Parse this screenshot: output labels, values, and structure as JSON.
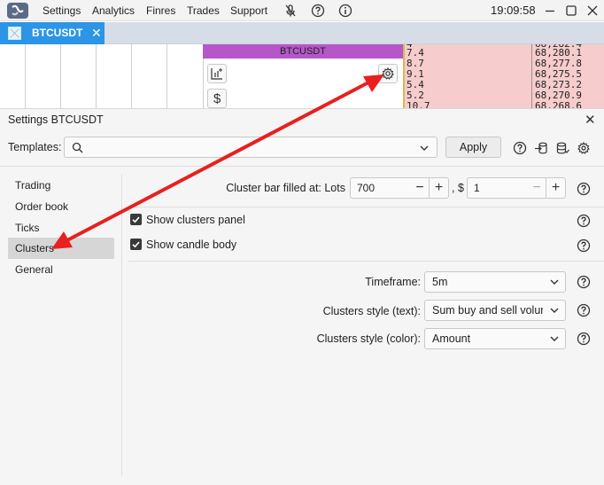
{
  "titlebar": {
    "menu": [
      "Settings",
      "Analytics",
      "Finres",
      "Trades",
      "Support"
    ],
    "clock": "19:09:58",
    "icons": [
      "mic-off-icon",
      "help-icon",
      "info-icon"
    ]
  },
  "tabs": [
    {
      "label": "BTCUSDT",
      "active": true
    }
  ],
  "chart_widget": {
    "title": "BTCUSDT"
  },
  "order_book": {
    "rows": [
      {
        "qty": "7.4",
        "price": "68,280.1"
      },
      {
        "qty": "8.7",
        "price": "68,277.8"
      },
      {
        "qty": "9.1",
        "price": "68,275.5"
      },
      {
        "qty": "5.4",
        "price": "68,273.2"
      },
      {
        "qty": "5.2",
        "price": "68,270.9"
      },
      {
        "qty": "10.7",
        "price": "68,268.6"
      }
    ]
  },
  "settings": {
    "title": "Settings BTCUSDT",
    "templates_label": "Templates:",
    "templates_value": "",
    "apply_label": "Apply",
    "sidebar": [
      {
        "label": "Trading",
        "active": false
      },
      {
        "label": "Order book",
        "active": false
      },
      {
        "label": "Ticks",
        "active": false
      },
      {
        "label": "Clusters",
        "active": true
      },
      {
        "label": "General",
        "active": false
      }
    ],
    "cluster_bar": {
      "label": "Cluster bar filled at: Lots",
      "lots_value": "700",
      "sep_label": ", $",
      "usd_value": "1"
    },
    "checkboxes": [
      {
        "label": "Show clusters panel",
        "checked": true
      },
      {
        "label": "Show candle body",
        "checked": true
      }
    ],
    "selects": [
      {
        "label": "Timeframe:",
        "value": "5m"
      },
      {
        "label": "Clusters style (text):",
        "value": "Sum buy and sell volume"
      },
      {
        "label": "Clusters style (color):",
        "value": "Amount"
      }
    ]
  },
  "colors": {
    "tab_active": "#2c95e6",
    "widget_header": "#b557c9",
    "order_book_ask": "#f6cccc",
    "annotation_arrow": "#e82020"
  }
}
